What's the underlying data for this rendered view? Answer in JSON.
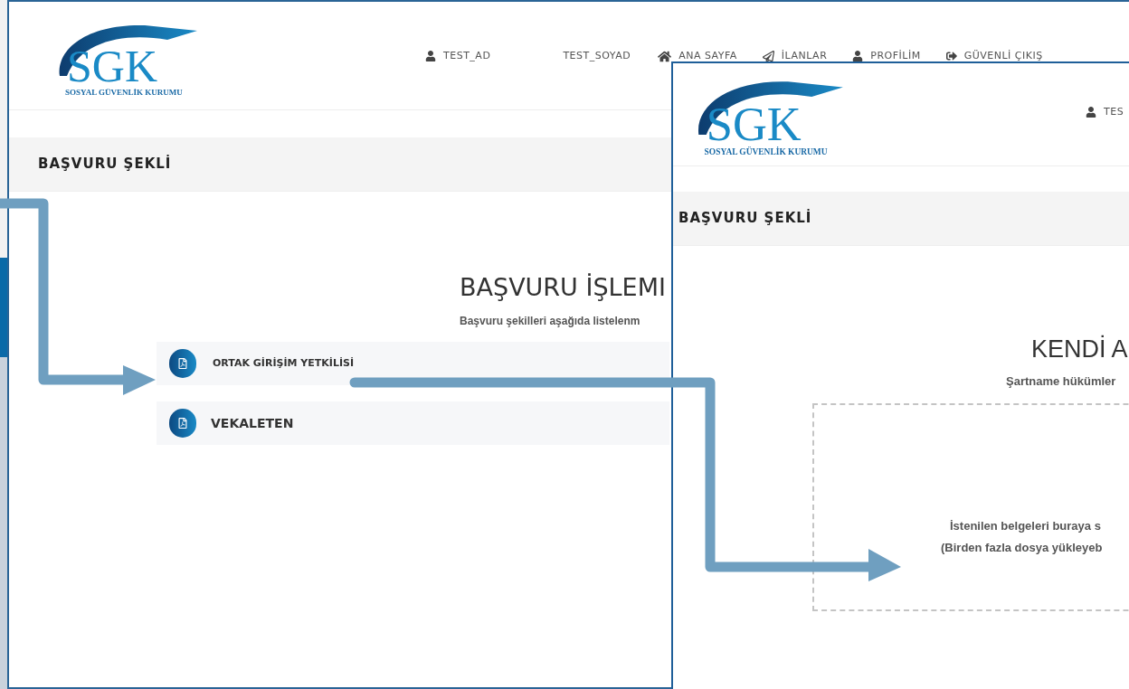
{
  "back_screen": {
    "logo": {
      "mark": "SGK",
      "caption": "SOSYAL GÜVENLİK KURUMU"
    },
    "nav": [
      {
        "label": "TEST_AD",
        "kind": "user"
      },
      {
        "label": "TEST_SOYAD",
        "kind": "plain"
      },
      {
        "label": "ANA SAYFA",
        "kind": "home"
      },
      {
        "label": "İLANLAR",
        "kind": "send"
      },
      {
        "label": "PROFİLİM",
        "kind": "user"
      },
      {
        "label": "GÜVENLİ ÇIKIŞ",
        "kind": "exit"
      }
    ],
    "section_title": "BAŞVURU ŞEKLİ",
    "heading": "BAŞVURU İŞLEMI",
    "subheading": "Başvuru şekilleri aşağıda listelenm",
    "options": [
      {
        "label": "ORTAK GİRİŞİM YETKİLİSİ",
        "kind": "small"
      },
      {
        "label": "VEKALETEN",
        "kind": "large"
      }
    ]
  },
  "front_screen": {
    "logo": {
      "mark": "SGK",
      "caption": "SOSYAL GÜVENLİK KURUMU"
    },
    "nav": [
      {
        "label": "TES",
        "kind": "user"
      }
    ],
    "section_title": "BAŞVURU ŞEKLİ",
    "heading": "KENDİ A",
    "subheading": "Şartname hükümler",
    "dropzone": {
      "line_1": "İstenilen belgeleri buraya s",
      "line_2": "(Birden fazla dosya yükleyeb"
    }
  }
}
